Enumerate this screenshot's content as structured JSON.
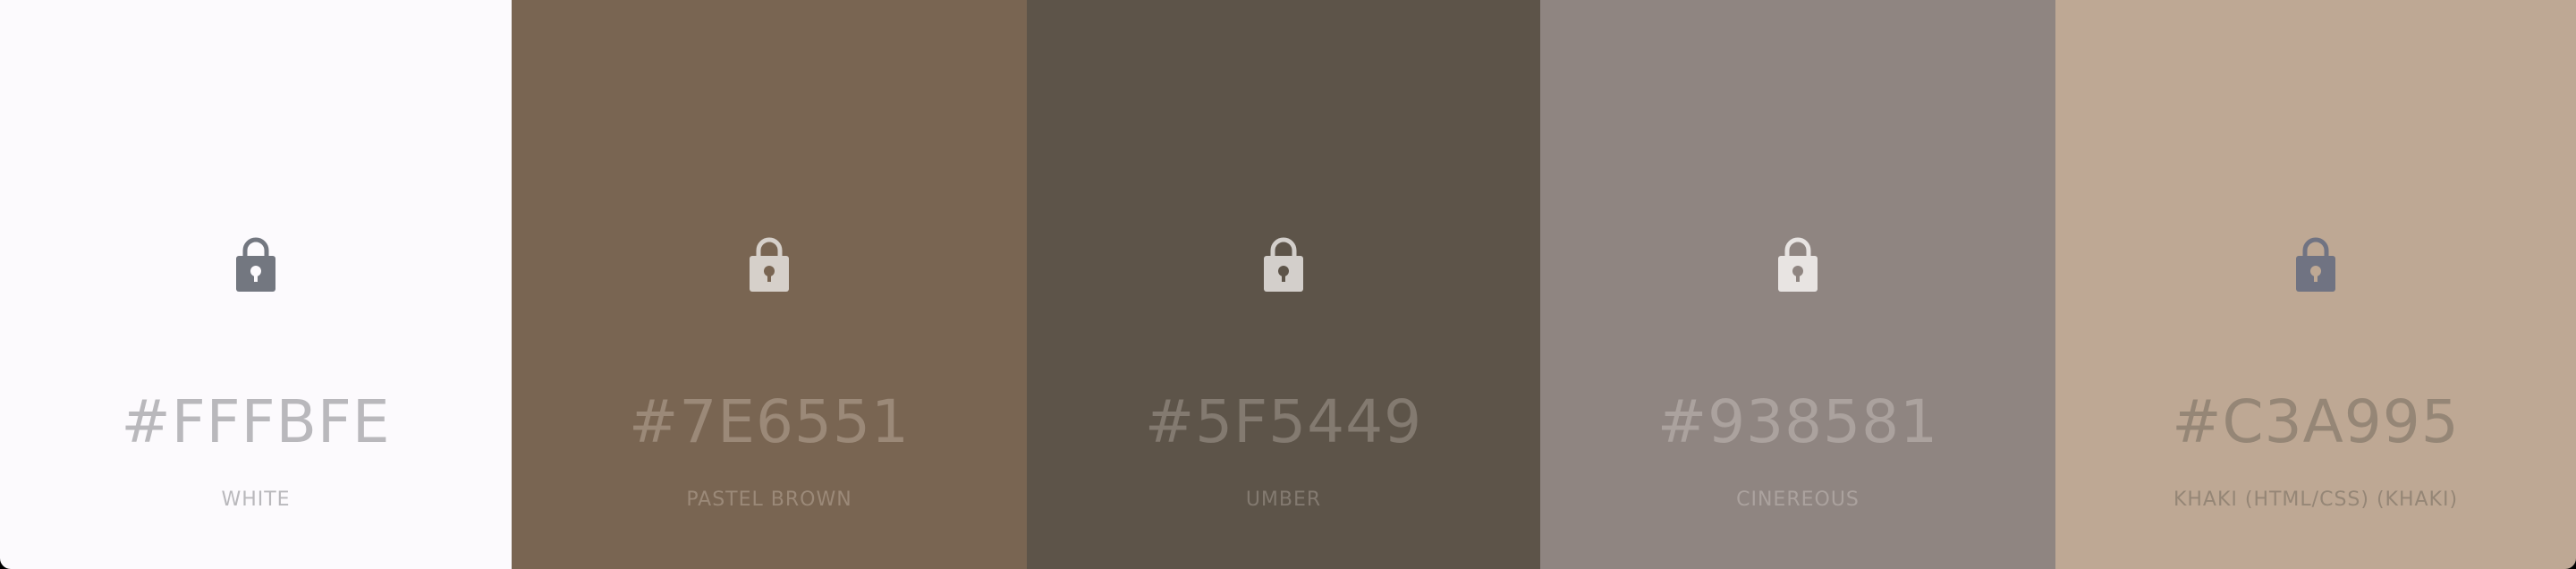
{
  "palette": {
    "swatches": [
      {
        "hex": "#FFFBFE",
        "name": "WHITE",
        "background": "#FCFAFD",
        "text_color": "#B9B8BC",
        "lock_color": "#737780",
        "lock_hole": "#FCFAFD",
        "icon": "lock-icon"
      },
      {
        "hex": "#7E6551",
        "name": "PASTEL BROWN",
        "background": "#796552",
        "text_color": "#9B8978",
        "lock_color": "#D6D0CA",
        "lock_hole": "#796552",
        "icon": "lock-icon"
      },
      {
        "hex": "#5F5449",
        "name": "UMBER",
        "background": "#5D5449",
        "text_color": "#837A70",
        "lock_color": "#D3CFCB",
        "lock_hole": "#5D5449",
        "icon": "lock-icon"
      },
      {
        "hex": "#938581",
        "name": "CINEREOUS",
        "background": "#8F8581",
        "text_color": "#ABA29E",
        "lock_color": "#E8E4E2",
        "lock_hole": "#8F8581",
        "icon": "lock-icon"
      },
      {
        "hex": "#C3A995",
        "name": "KHAKI (HTML/CSS) (KHAKI)",
        "background": "#BEA894",
        "text_color": "#958676",
        "lock_color": "#707382",
        "lock_hole": "#BEA894",
        "icon": "lock-icon"
      }
    ]
  }
}
